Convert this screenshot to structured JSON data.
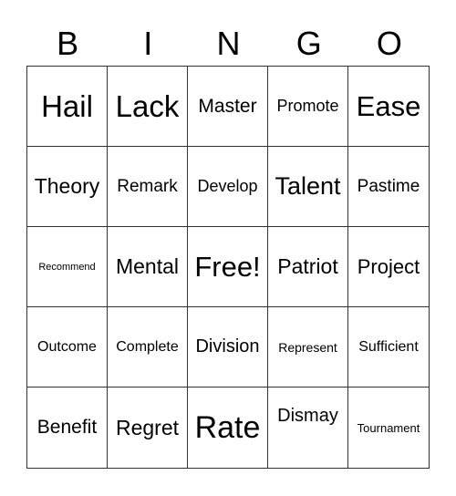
{
  "header": [
    "B",
    "I",
    "N",
    "G",
    "O"
  ],
  "cells": [
    "Hail",
    "Lack",
    "Master",
    "Promote",
    "Ease",
    "Theory",
    "Remark",
    "Develop",
    "Talent",
    "Pastime",
    "Recommend",
    "Mental",
    "Free!",
    "Patriot",
    "Project",
    "Outcome",
    "Complete",
    "Division",
    "Represent",
    "Sufficient",
    "Benefit",
    "Regret",
    "Rate",
    "Dismay",
    "Tournament"
  ]
}
